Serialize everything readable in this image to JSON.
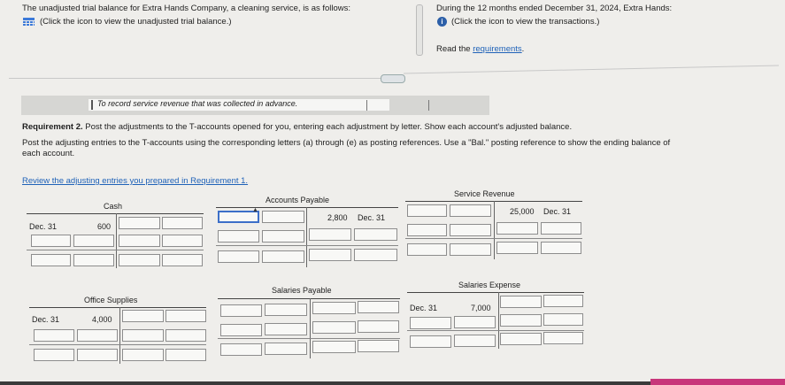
{
  "instructions": {
    "left_line1": "The unadjusted trial balance for Extra Hands Company, a cleaning service, is as follows:",
    "left_line2": "(Click the icon to view the unadjusted trial balance.)",
    "right_line1": "During the 12 months ended December 31, 2024, Extra Hands:",
    "right_line2": "(Click the icon to view the transactions.)",
    "read_requirements": "Read the requirements."
  },
  "banner": {
    "text": "To record service revenue that was collected in advance."
  },
  "requirement": {
    "line1_bold": "Requirement 2.",
    "line1_rest": " Post the adjustments to the T-accounts opened for you, entering each adjustment by letter. Show each account's adjusted balance.",
    "line2": "Post the adjusting entries to the T-accounts using the corresponding letters (a) through (e) as posting references. Use a \"Bal.\" posting reference to show the ending balance of",
    "line3": "each account.",
    "review_link": "Review the adjusting entries you prepared in Requirement 1."
  },
  "t_accounts": {
    "cash": {
      "title": "Cash",
      "row1_label": "Dec. 31",
      "row1_amount": "600"
    },
    "accounts_payable": {
      "title": "Accounts Payable",
      "row1_amount": "2,800",
      "row1_label": "Dec. 31"
    },
    "service_revenue": {
      "title": "Service Revenue",
      "row1_amount": "25,000",
      "row1_label": "Dec. 31"
    },
    "office_supplies": {
      "title": "Office Supplies",
      "row1_label": "Dec. 31",
      "row1_amount": "4,000"
    },
    "salaries_payable": {
      "title": "Salaries Payable"
    },
    "salaries_expense": {
      "title": "Salaries Expense",
      "row1_label": "Dec. 31",
      "row1_amount": "7,000"
    }
  },
  "icons": {
    "trial_balance": "table-grid-icon",
    "transactions": "info-icon"
  },
  "colors": {
    "link": "#1f62b8",
    "focus_border": "#3c6fc8"
  }
}
